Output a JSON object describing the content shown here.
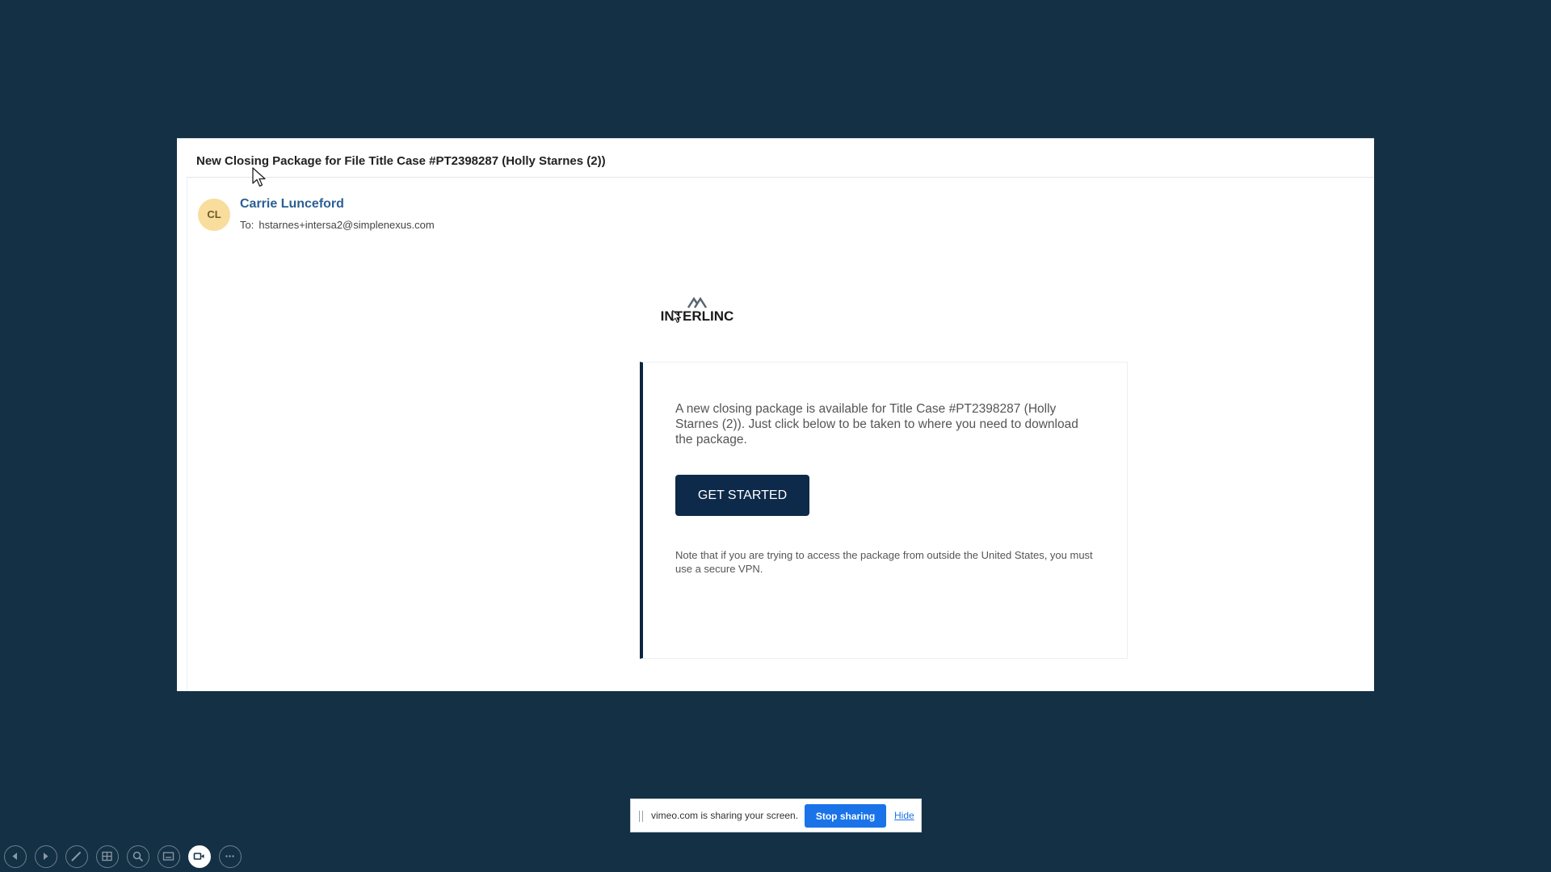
{
  "email": {
    "subject": "New Closing Package for File Title Case #PT2398287 (Holly Starnes (2))",
    "sender": {
      "initials": "CL",
      "name": "Carrie Lunceford"
    },
    "recipient": {
      "label": "To:",
      "address": "hstarnes+intersa2@simplenexus.com"
    },
    "logo": {
      "text": "INTERLINC",
      "icon": "mountain-peaks-icon"
    },
    "card": {
      "body": "A new closing package is available for Title Case #PT2398287 (Holly Starnes (2)). Just click below to be taken to where you need to download the package.",
      "button_label": "GET STARTED",
      "note": "Note that if you are trying to access the package from outside the United States, you must use a secure VPN."
    }
  },
  "share_bar": {
    "message": "vimeo.com is sharing your screen.",
    "stop_label": "Stop sharing",
    "hide_label": "Hide"
  },
  "toolbar": {
    "tools": [
      {
        "icon": "previous-icon"
      },
      {
        "icon": "next-icon"
      },
      {
        "icon": "pen-icon"
      },
      {
        "icon": "slides-grid-icon"
      },
      {
        "icon": "zoom-icon"
      },
      {
        "icon": "subtitles-icon"
      },
      {
        "icon": "camera-icon",
        "active": true
      },
      {
        "icon": "more-icon"
      }
    ]
  },
  "colors": {
    "background": "#143045",
    "button_navy": "#0e2a4a",
    "link_blue": "#2b5f93",
    "avatar_bg": "#f9dd9c",
    "share_blue": "#1a73e8"
  }
}
